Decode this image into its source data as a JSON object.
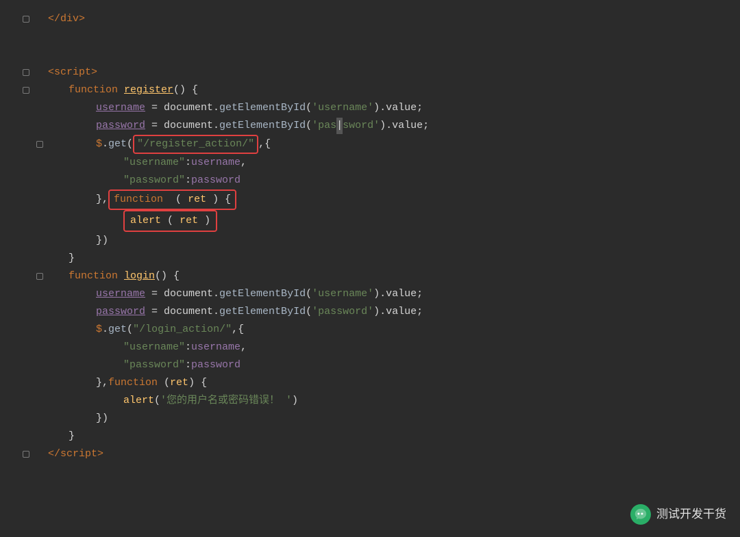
{
  "code": {
    "lines": [
      {
        "id": "l1",
        "indent": 1,
        "gutter": "arrow",
        "content": "closing_div"
      },
      {
        "id": "l2",
        "indent": 0,
        "gutter": "none",
        "content": "blank"
      },
      {
        "id": "l3",
        "indent": 0,
        "gutter": "none",
        "content": "blank"
      },
      {
        "id": "l4",
        "indent": 0,
        "gutter": "arrow",
        "content": "script_open"
      },
      {
        "id": "l5",
        "indent": 1,
        "gutter": "arrow",
        "content": "func_register"
      },
      {
        "id": "l6",
        "indent": 2,
        "gutter": "none",
        "content": "username_assign"
      },
      {
        "id": "l7",
        "indent": 2,
        "gutter": "none",
        "content": "password_assign"
      },
      {
        "id": "l8",
        "indent": 2,
        "gutter": "arrow",
        "content": "get_register"
      },
      {
        "id": "l9",
        "indent": 3,
        "gutter": "none",
        "content": "username_key"
      },
      {
        "id": "l10",
        "indent": 3,
        "gutter": "none",
        "content": "password_key"
      },
      {
        "id": "l11",
        "indent": 2,
        "gutter": "none",
        "content": "func_ret_open"
      },
      {
        "id": "l12",
        "indent": 3,
        "gutter": "none",
        "content": "alert_ret"
      },
      {
        "id": "l13",
        "indent": 2,
        "gutter": "none",
        "content": "close_bracket"
      },
      {
        "id": "l14",
        "indent": 1,
        "gutter": "none",
        "content": "close_brace"
      },
      {
        "id": "l15",
        "indent": 1,
        "gutter": "arrow",
        "content": "func_login"
      },
      {
        "id": "l16",
        "indent": 2,
        "gutter": "none",
        "content": "username_assign2"
      },
      {
        "id": "l17",
        "indent": 2,
        "gutter": "none",
        "content": "password_assign2"
      },
      {
        "id": "l18",
        "indent": 2,
        "gutter": "none",
        "content": "get_login"
      },
      {
        "id": "l19",
        "indent": 3,
        "gutter": "none",
        "content": "username_key2"
      },
      {
        "id": "l20",
        "indent": 3,
        "gutter": "none",
        "content": "password_key2"
      },
      {
        "id": "l21",
        "indent": 2,
        "gutter": "none",
        "content": "func_ret2_open"
      },
      {
        "id": "l22",
        "indent": 3,
        "gutter": "none",
        "content": "alert_chinese"
      },
      {
        "id": "l23",
        "indent": 2,
        "gutter": "none",
        "content": "close_bracket2"
      },
      {
        "id": "l24",
        "indent": 1,
        "gutter": "none",
        "content": "close_brace2"
      },
      {
        "id": "l25",
        "indent": 0,
        "gutter": "arrow",
        "content": "script_close"
      }
    ],
    "watermark": {
      "icon": "🍀",
      "text": "测试开发干货"
    }
  }
}
